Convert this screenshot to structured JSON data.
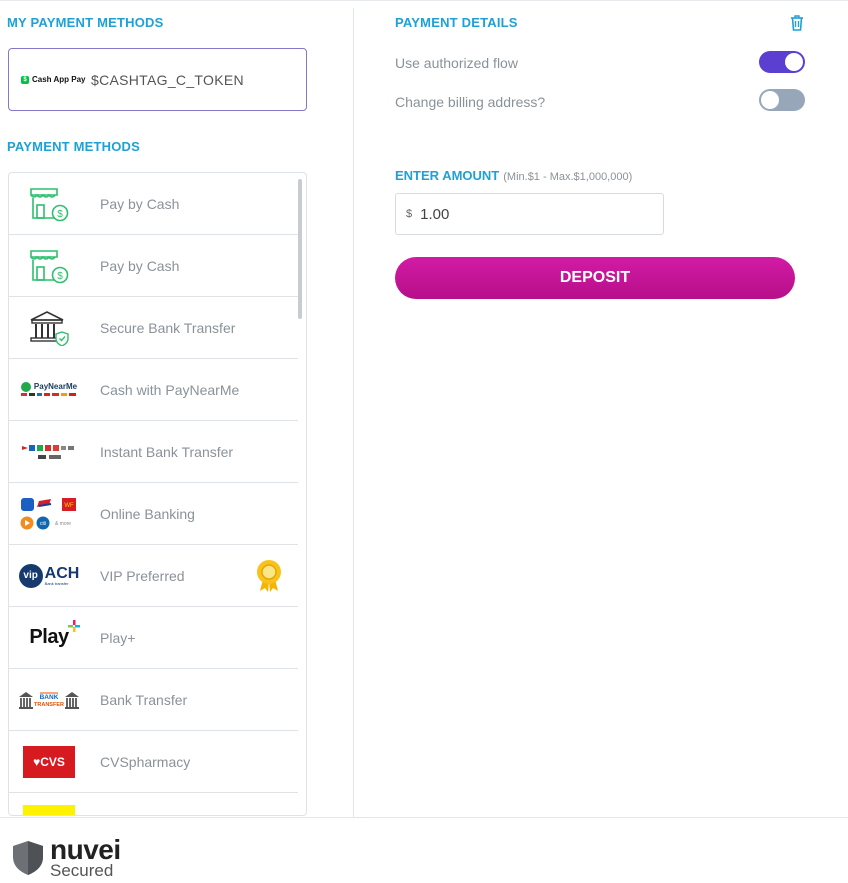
{
  "my_methods": {
    "title": "MY PAYMENT METHODS",
    "saved": {
      "logo_text": "Cash App Pay",
      "logo_mark": "$",
      "label": "$CASHTAG_C_TOKEN"
    }
  },
  "methods": {
    "title": "PAYMENT METHODS",
    "items": [
      {
        "label": "Pay by Cash",
        "icon": "store-cash-icon"
      },
      {
        "label": "Pay by Cash",
        "icon": "store-cash-icon"
      },
      {
        "label": "Secure Bank Transfer",
        "icon": "bank-shield-icon"
      },
      {
        "label": "Cash with PayNearMe",
        "icon": "paynearme-logo",
        "logo_text": "PayNearMe"
      },
      {
        "label": "Instant Bank Transfer",
        "icon": "bank-logos-icon"
      },
      {
        "label": "Online Banking",
        "icon": "online-banking-logos",
        "logo_text": "& more"
      },
      {
        "label": "VIP Preferred",
        "icon": "vip-ach-logo",
        "logo_text": "ACH",
        "logo_mark": "vip",
        "logo_sub": "Bank transfer",
        "badge": "award-badge-icon"
      },
      {
        "label": "Play+",
        "icon": "play-plus-logo",
        "logo_text": "Play"
      },
      {
        "label": "Bank Transfer",
        "icon": "bank-transfer-logo",
        "logo_text": "BANK TRANSFER"
      },
      {
        "label": "CVSpharmacy",
        "icon": "cvs-logo",
        "logo_text": "♥CVS"
      }
    ]
  },
  "details": {
    "title": "PAYMENT DETAILS",
    "options": [
      {
        "label": "Use authorized flow",
        "state": "on"
      },
      {
        "label": "Change billing address?",
        "state": "off"
      }
    ]
  },
  "amount": {
    "title": "ENTER AMOUNT",
    "range": "(Min.$1 - Max.$1,000,000)",
    "currency": "$",
    "value": "1.00"
  },
  "deposit_label": "DEPOSIT",
  "footer": {
    "brand": "nuvei",
    "sub": "Secured"
  },
  "colors": {
    "accent": "#1ea1d6",
    "toggle_on": "#5b3fd0",
    "deposit": "#c8159a",
    "selected_border": "#8479c9"
  }
}
